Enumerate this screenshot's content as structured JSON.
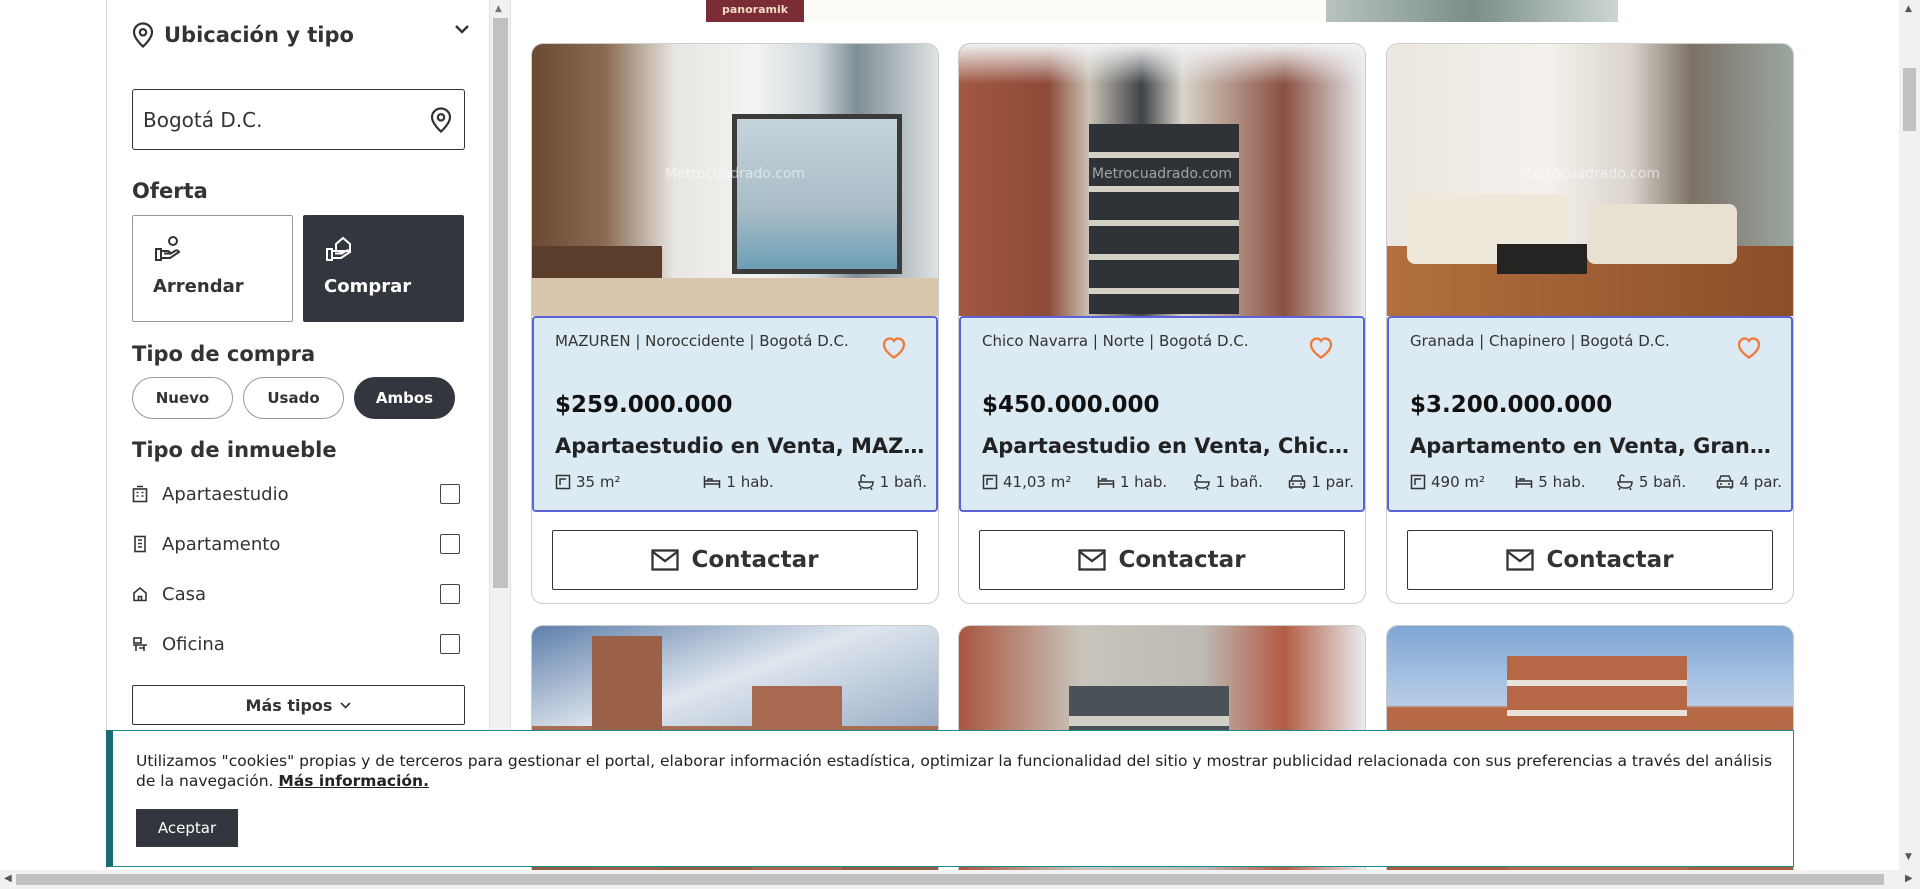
{
  "sidebar": {
    "location_title": "Ubicación y tipo",
    "location_value": "Bogotá D.C.",
    "offer_label": "Oferta",
    "offers": [
      {
        "label": "Arrendar",
        "active": false
      },
      {
        "label": "Comprar",
        "active": true
      }
    ],
    "purchase_type_label": "Tipo de compra",
    "purchase_types": [
      {
        "label": "Nuevo",
        "active": false
      },
      {
        "label": "Usado",
        "active": false
      },
      {
        "label": "Ambos",
        "active": true
      }
    ],
    "property_type_label": "Tipo de inmueble",
    "property_types": [
      {
        "label": "Apartaestudio",
        "icon": "building-icon",
        "checked": false
      },
      {
        "label": "Apartamento",
        "icon": "apartment-icon",
        "checked": false
      },
      {
        "label": "Casa",
        "icon": "house-icon",
        "checked": false
      },
      {
        "label": "Oficina",
        "icon": "office-icon",
        "checked": false
      }
    ],
    "more_types_label": "Más tipos"
  },
  "banner": {
    "brand": "panoramik"
  },
  "listings": [
    {
      "location": "MAZUREN | Noroccidente | Bogotá D.C.",
      "price": "$259.000.000",
      "title": "Apartaestudio en Venta, MAZUREN",
      "area": "35 m²",
      "rooms": "1 hab.",
      "baths": "1 bañ.",
      "parking": "",
      "watermark": "Metrocuadrado.com"
    },
    {
      "location": "Chico Navarra | Norte | Bogotá D.C.",
      "price": "$450.000.000",
      "title": "Apartaestudio en Venta, Chico Navarra",
      "area": "41,03 m²",
      "rooms": "1 hab.",
      "baths": "1 bañ.",
      "parking": "1 par.",
      "watermark": "Metrocuadrado.com"
    },
    {
      "location": "Granada | Chapinero | Bogotá D.C.",
      "price": "$3.200.000.000",
      "title": "Apartamento en Venta, Granada, Chapinero",
      "area": "490 m²",
      "rooms": "5 hab.",
      "baths": "5 bañ.",
      "parking": "4 par.",
      "watermark": "Metrocuadrado.com"
    }
  ],
  "contact_label": "Contactar",
  "cookie": {
    "text": "Utilizamos \"cookies\" propias y de terceros para gestionar el portal, elaborar información estadística, optimizar la funcionalidad del sitio y mostrar publicidad relacionada con sus preferencias a través del análisis de la navegación.",
    "more_link": "Más información.",
    "accept": "Aceptar"
  },
  "colors": {
    "dark": "#33373d",
    "card_info_bg": "#dceaf3",
    "card_border_accent": "#5b64d7",
    "heart": "#f07a3a",
    "cookie_border": "#1a6b78"
  }
}
